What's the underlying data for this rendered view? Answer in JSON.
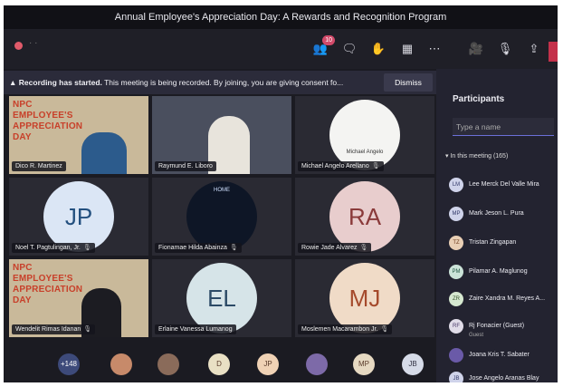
{
  "window": {
    "title": "Annual Employee's Appreciation Day: A Rewards and Recognition Program"
  },
  "toolbar": {
    "participants_badge": "10"
  },
  "banner": {
    "bold": "Recording has started.",
    "message": " This meeting is being recorded. By joining, you are giving consent fo...",
    "dismiss": "Dismiss"
  },
  "tiles": [
    {
      "name": "Dico R. Martinez",
      "banner": "NPC EMPLOYEE'S APPRECIATION DAY"
    },
    {
      "name": "Raymund E. Liboro"
    },
    {
      "name": "Michael Angelo Arellano",
      "logo_text": "Michael Angelo"
    },
    {
      "name": "Noel T. Pagtulingan, Jr.",
      "initials": "JP"
    },
    {
      "name": "Fionamae Hilda Abainza",
      "avatar_text": "HOME"
    },
    {
      "name": "Rowie Jade Alvarez",
      "initials": "RA"
    },
    {
      "name": "Wendelit Rimas Idanan",
      "banner": "NPC EMPLOYEE'S APPRECIATION DAY"
    },
    {
      "name": "Erlaine Vanessa Lumanog",
      "initials": "EL"
    },
    {
      "name": "Moslemen Macarambon Jr.",
      "initials": "MJ"
    }
  ],
  "bottom_bar": {
    "overflow_count": "+148",
    "avatars": [
      "D",
      "JP",
      "MP",
      "JB"
    ]
  },
  "panel": {
    "title": "Participants",
    "search_placeholder": "Type a name",
    "section": "In this meeting (165)",
    "people": [
      {
        "initials": "LM",
        "name": "Lee Merck Del Valle Mira"
      },
      {
        "initials": "MP",
        "name": "Mark Jeson L. Pura"
      },
      {
        "initials": "TZ",
        "name": "Tristan Zingapan"
      },
      {
        "initials": "PM",
        "name": "Pilamar A. Maglunog"
      },
      {
        "initials": "ZR",
        "name": "Zaire Xandra M. Reyes A..."
      },
      {
        "initials": "RF",
        "name": "Rj Fonacier (Guest)",
        "sub": "Guest"
      },
      {
        "initials": "",
        "name": "Joana Kris T. Sabater"
      },
      {
        "initials": "JB",
        "name": "Jose Angelo Aranas Blay"
      }
    ]
  }
}
